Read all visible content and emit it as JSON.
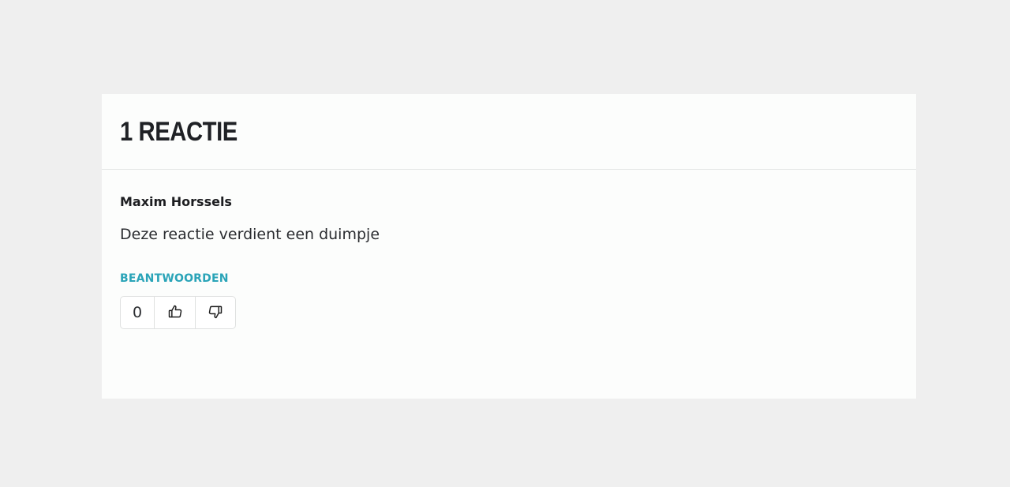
{
  "comments_section": {
    "title": "1 REACTIE",
    "comment": {
      "author": "Maxim Horssels",
      "text": "Deze reactie verdient een duimpje",
      "reply_label": "BEANTWOORDEN",
      "vote_count": "0"
    }
  },
  "icons": {
    "upvote": "thumbs-up-icon",
    "downvote": "thumbs-down-icon"
  },
  "colors": {
    "page_background": "#efefef",
    "card_background": "#fcfdfc",
    "accent": "#2aa4b8",
    "text": "#1c1d20"
  }
}
